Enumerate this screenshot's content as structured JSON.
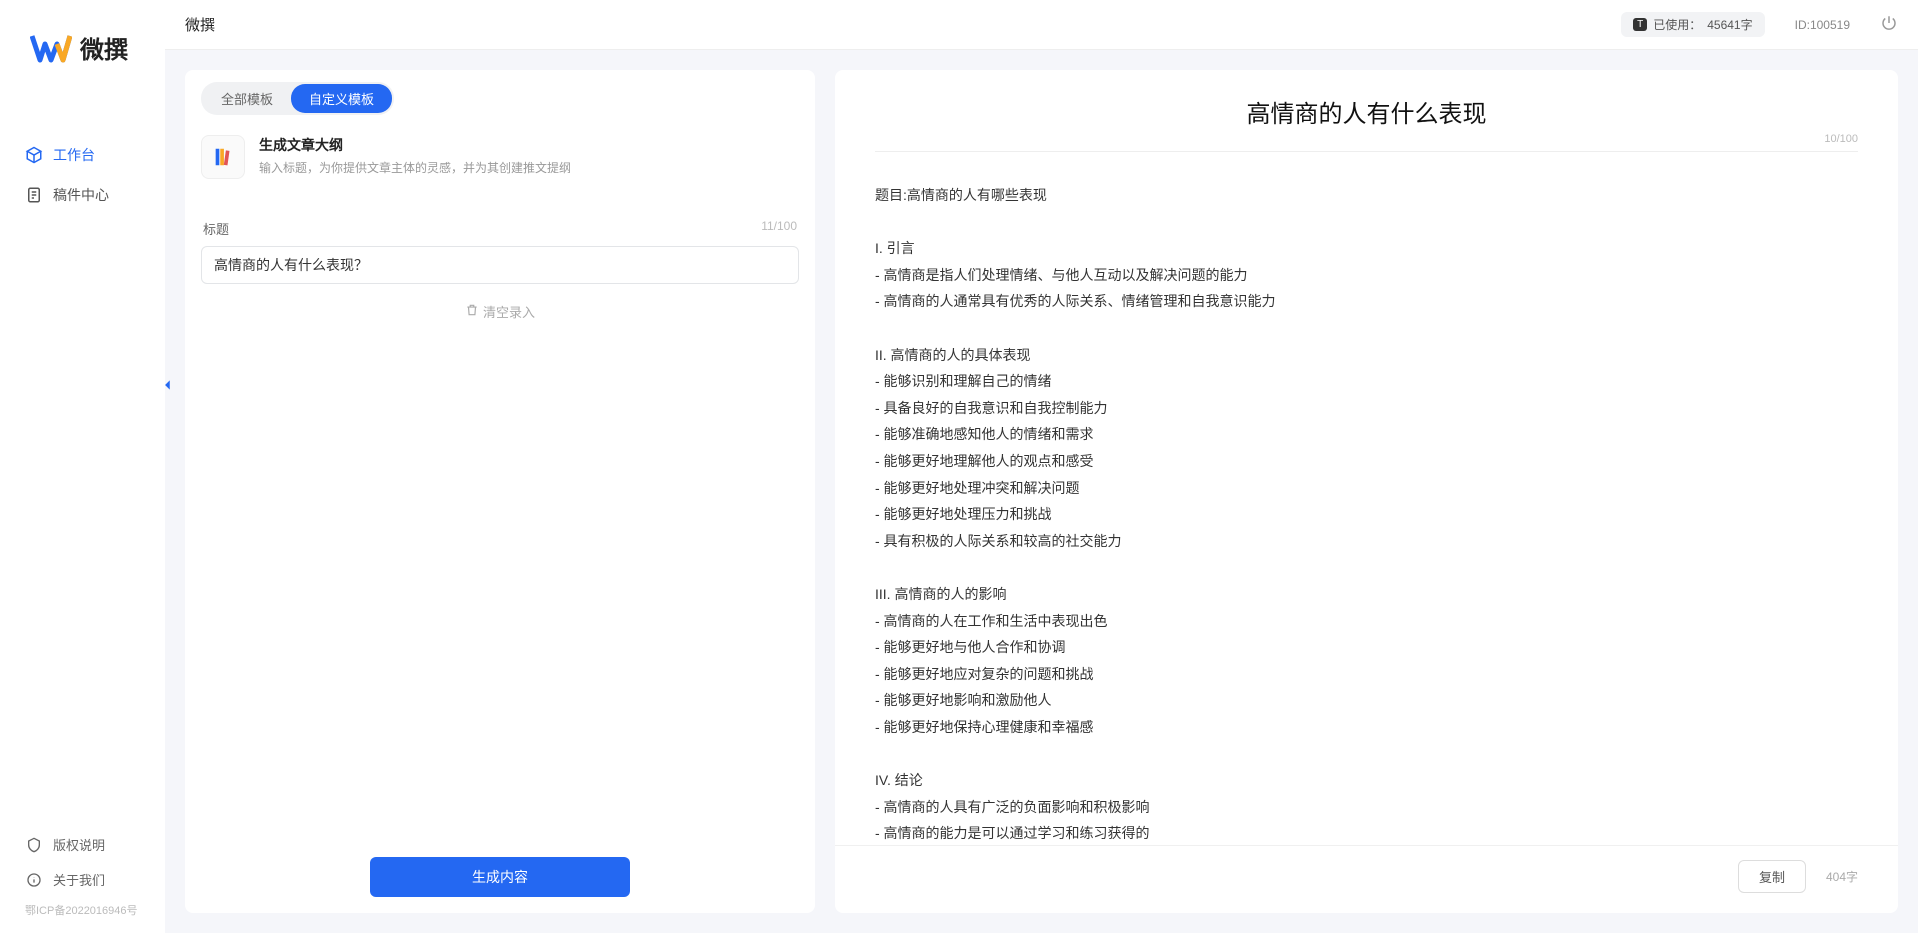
{
  "app": {
    "logo_text": "微撰",
    "topbar_title": "微撰"
  },
  "sidebar": {
    "items": [
      {
        "label": "工作台"
      },
      {
        "label": "稿件中心"
      }
    ],
    "bottom": [
      {
        "label": "版权说明"
      },
      {
        "label": "关于我们"
      }
    ],
    "icp": "鄂ICP备2022016946号"
  },
  "usage": {
    "badge": "T",
    "prefix": "已使用：",
    "value": "45641字"
  },
  "id_label": "ID:100519",
  "tabs": {
    "all": "全部模板",
    "custom": "自定义模板"
  },
  "template": {
    "title": "生成文章大纲",
    "desc": "输入标题，为你提供文章主体的灵感，并为其创建推文提纲"
  },
  "form": {
    "title_label": "标题",
    "title_counter": "11/100",
    "title_value": "高情商的人有什么表现？",
    "clear_label": "清空录入",
    "generate_label": "生成内容"
  },
  "output": {
    "title": "高情商的人有什么表现",
    "title_counter": "10/100",
    "body": "题目:高情商的人有哪些表现\n\nI. 引言\n- 高情商是指人们处理情绪、与他人互动以及解决问题的能力\n- 高情商的人通常具有优秀的人际关系、情绪管理和自我意识能力\n\nII. 高情商的人的具体表现\n- 能够识别和理解自己的情绪\n- 具备良好的自我意识和自我控制能力\n- 能够准确地感知他人的情绪和需求\n- 能够更好地理解他人的观点和感受\n- 能够更好地处理冲突和解决问题\n- 能够更好地处理压力和挑战\n- 具有积极的人际关系和较高的社交能力\n\nIII. 高情商的人的影响\n- 高情商的人在工作和生活中表现出色\n- 能够更好地与他人合作和协调\n- 能够更好地应对复杂的问题和挑战\n- 能够更好地影响和激励他人\n- 能够更好地保持心理健康和幸福感\n\nIV. 结论\n- 高情商的人具有广泛的负面影响和积极影响\n- 高情商的能力是可以通过学习和练习获得的\n- 培养和提高高情商的能力对于个人的职业发展和生活质量至关重要。",
    "copy_label": "复制",
    "word_count": "404字"
  }
}
